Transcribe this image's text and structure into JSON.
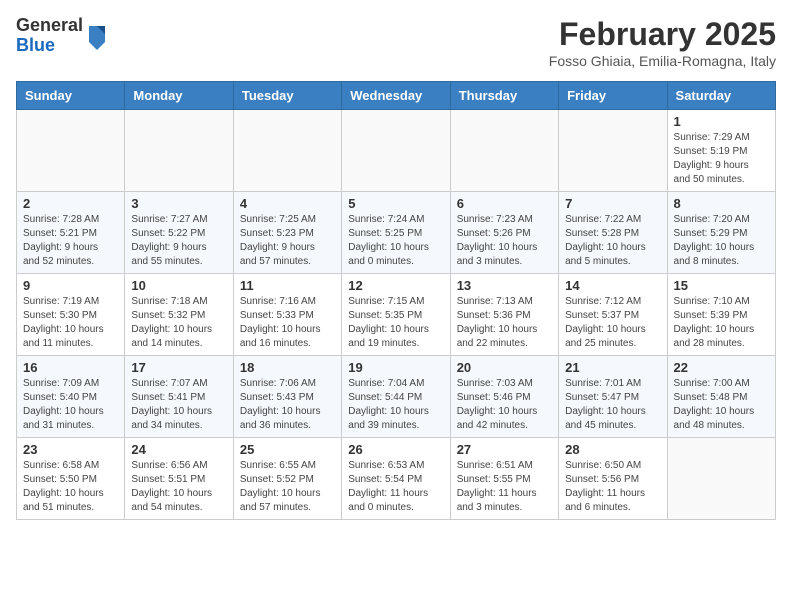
{
  "header": {
    "logo": {
      "general": "General",
      "blue": "Blue"
    },
    "month": "February 2025",
    "location": "Fosso Ghiaia, Emilia-Romagna, Italy"
  },
  "weekdays": [
    "Sunday",
    "Monday",
    "Tuesday",
    "Wednesday",
    "Thursday",
    "Friday",
    "Saturday"
  ],
  "weeks": [
    [
      {
        "day": "",
        "info": ""
      },
      {
        "day": "",
        "info": ""
      },
      {
        "day": "",
        "info": ""
      },
      {
        "day": "",
        "info": ""
      },
      {
        "day": "",
        "info": ""
      },
      {
        "day": "",
        "info": ""
      },
      {
        "day": "1",
        "info": "Sunrise: 7:29 AM\nSunset: 5:19 PM\nDaylight: 9 hours\nand 50 minutes."
      }
    ],
    [
      {
        "day": "2",
        "info": "Sunrise: 7:28 AM\nSunset: 5:21 PM\nDaylight: 9 hours\nand 52 minutes."
      },
      {
        "day": "3",
        "info": "Sunrise: 7:27 AM\nSunset: 5:22 PM\nDaylight: 9 hours\nand 55 minutes."
      },
      {
        "day": "4",
        "info": "Sunrise: 7:25 AM\nSunset: 5:23 PM\nDaylight: 9 hours\nand 57 minutes."
      },
      {
        "day": "5",
        "info": "Sunrise: 7:24 AM\nSunset: 5:25 PM\nDaylight: 10 hours\nand 0 minutes."
      },
      {
        "day": "6",
        "info": "Sunrise: 7:23 AM\nSunset: 5:26 PM\nDaylight: 10 hours\nand 3 minutes."
      },
      {
        "day": "7",
        "info": "Sunrise: 7:22 AM\nSunset: 5:28 PM\nDaylight: 10 hours\nand 5 minutes."
      },
      {
        "day": "8",
        "info": "Sunrise: 7:20 AM\nSunset: 5:29 PM\nDaylight: 10 hours\nand 8 minutes."
      }
    ],
    [
      {
        "day": "9",
        "info": "Sunrise: 7:19 AM\nSunset: 5:30 PM\nDaylight: 10 hours\nand 11 minutes."
      },
      {
        "day": "10",
        "info": "Sunrise: 7:18 AM\nSunset: 5:32 PM\nDaylight: 10 hours\nand 14 minutes."
      },
      {
        "day": "11",
        "info": "Sunrise: 7:16 AM\nSunset: 5:33 PM\nDaylight: 10 hours\nand 16 minutes."
      },
      {
        "day": "12",
        "info": "Sunrise: 7:15 AM\nSunset: 5:35 PM\nDaylight: 10 hours\nand 19 minutes."
      },
      {
        "day": "13",
        "info": "Sunrise: 7:13 AM\nSunset: 5:36 PM\nDaylight: 10 hours\nand 22 minutes."
      },
      {
        "day": "14",
        "info": "Sunrise: 7:12 AM\nSunset: 5:37 PM\nDaylight: 10 hours\nand 25 minutes."
      },
      {
        "day": "15",
        "info": "Sunrise: 7:10 AM\nSunset: 5:39 PM\nDaylight: 10 hours\nand 28 minutes."
      }
    ],
    [
      {
        "day": "16",
        "info": "Sunrise: 7:09 AM\nSunset: 5:40 PM\nDaylight: 10 hours\nand 31 minutes."
      },
      {
        "day": "17",
        "info": "Sunrise: 7:07 AM\nSunset: 5:41 PM\nDaylight: 10 hours\nand 34 minutes."
      },
      {
        "day": "18",
        "info": "Sunrise: 7:06 AM\nSunset: 5:43 PM\nDaylight: 10 hours\nand 36 minutes."
      },
      {
        "day": "19",
        "info": "Sunrise: 7:04 AM\nSunset: 5:44 PM\nDaylight: 10 hours\nand 39 minutes."
      },
      {
        "day": "20",
        "info": "Sunrise: 7:03 AM\nSunset: 5:46 PM\nDaylight: 10 hours\nand 42 minutes."
      },
      {
        "day": "21",
        "info": "Sunrise: 7:01 AM\nSunset: 5:47 PM\nDaylight: 10 hours\nand 45 minutes."
      },
      {
        "day": "22",
        "info": "Sunrise: 7:00 AM\nSunset: 5:48 PM\nDaylight: 10 hours\nand 48 minutes."
      }
    ],
    [
      {
        "day": "23",
        "info": "Sunrise: 6:58 AM\nSunset: 5:50 PM\nDaylight: 10 hours\nand 51 minutes."
      },
      {
        "day": "24",
        "info": "Sunrise: 6:56 AM\nSunset: 5:51 PM\nDaylight: 10 hours\nand 54 minutes."
      },
      {
        "day": "25",
        "info": "Sunrise: 6:55 AM\nSunset: 5:52 PM\nDaylight: 10 hours\nand 57 minutes."
      },
      {
        "day": "26",
        "info": "Sunrise: 6:53 AM\nSunset: 5:54 PM\nDaylight: 11 hours\nand 0 minutes."
      },
      {
        "day": "27",
        "info": "Sunrise: 6:51 AM\nSunset: 5:55 PM\nDaylight: 11 hours\nand 3 minutes."
      },
      {
        "day": "28",
        "info": "Sunrise: 6:50 AM\nSunset: 5:56 PM\nDaylight: 11 hours\nand 6 minutes."
      },
      {
        "day": "",
        "info": ""
      }
    ]
  ]
}
